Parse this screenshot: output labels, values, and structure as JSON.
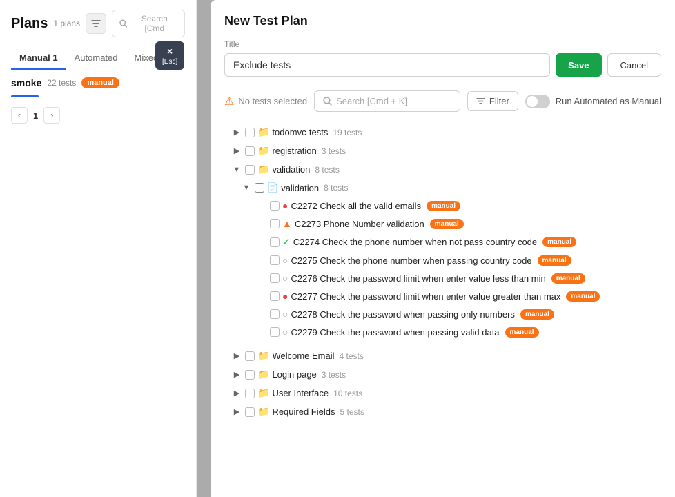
{
  "left": {
    "title": "Plans",
    "count": "1 plans",
    "search_placeholder": "Search [Cmd",
    "tabs": [
      "Manual 1",
      "Automated",
      "Mixed"
    ],
    "active_tab": "Manual 1",
    "smoke": {
      "label": "smoke",
      "count": "22 tests",
      "tag": "manual"
    },
    "pagination": {
      "prev": "‹",
      "current": "1",
      "next": "›"
    }
  },
  "esc_popup": {
    "x": "×",
    "label": "[Esc]"
  },
  "modal": {
    "title": "New Test Plan",
    "title_label": "Title",
    "title_value": "Exclude tests",
    "save_label": "Save",
    "cancel_label": "Cancel",
    "no_tests_label": "No tests selected",
    "search_placeholder": "Search [Cmd + K]",
    "filter_label": "Filter",
    "run_automated_label": "Run Automated as Manual",
    "folders": [
      {
        "name": "todomvc-tests",
        "count": "19 tests",
        "expanded": false
      },
      {
        "name": "registration",
        "count": "3 tests",
        "expanded": false
      },
      {
        "name": "validation",
        "count": "8 tests",
        "expanded": true,
        "children": [
          {
            "name": "validation",
            "count": "8 tests",
            "expanded": true,
            "type": "file",
            "tests": [
              {
                "id": "C2272",
                "name": "Check all the valid emails",
                "status": "red",
                "tag": "manual"
              },
              {
                "id": "C2273",
                "name": "Phone Number validation",
                "status": "orange",
                "tag": "manual"
              },
              {
                "id": "C2274",
                "name": "Check the phone number when not pass country code",
                "status": "green",
                "tag": "manual"
              },
              {
                "id": "C2275",
                "name": "Check the phone number when passing country code",
                "status": "gray",
                "tag": "manual"
              },
              {
                "id": "C2276",
                "name": "Check the password limit when enter value less than min",
                "status": "gray",
                "tag": "manual"
              },
              {
                "id": "C2277",
                "name": "Check the password limit when enter value greater than max",
                "status": "red",
                "tag": "manual"
              },
              {
                "id": "C2278",
                "name": "Check the password when passing only numbers",
                "status": "gray",
                "tag": "manual"
              },
              {
                "id": "C2279",
                "name": "Check the password when passing valid data",
                "status": "gray",
                "tag": "manual"
              }
            ]
          }
        ]
      },
      {
        "name": "Welcome Email",
        "count": "4 tests",
        "expanded": false
      },
      {
        "name": "Login page",
        "count": "3 tests",
        "expanded": false
      },
      {
        "name": "User Interface",
        "count": "10 tests",
        "expanded": false
      },
      {
        "name": "Required Fields",
        "count": "5 tests",
        "expanded": false
      }
    ]
  }
}
